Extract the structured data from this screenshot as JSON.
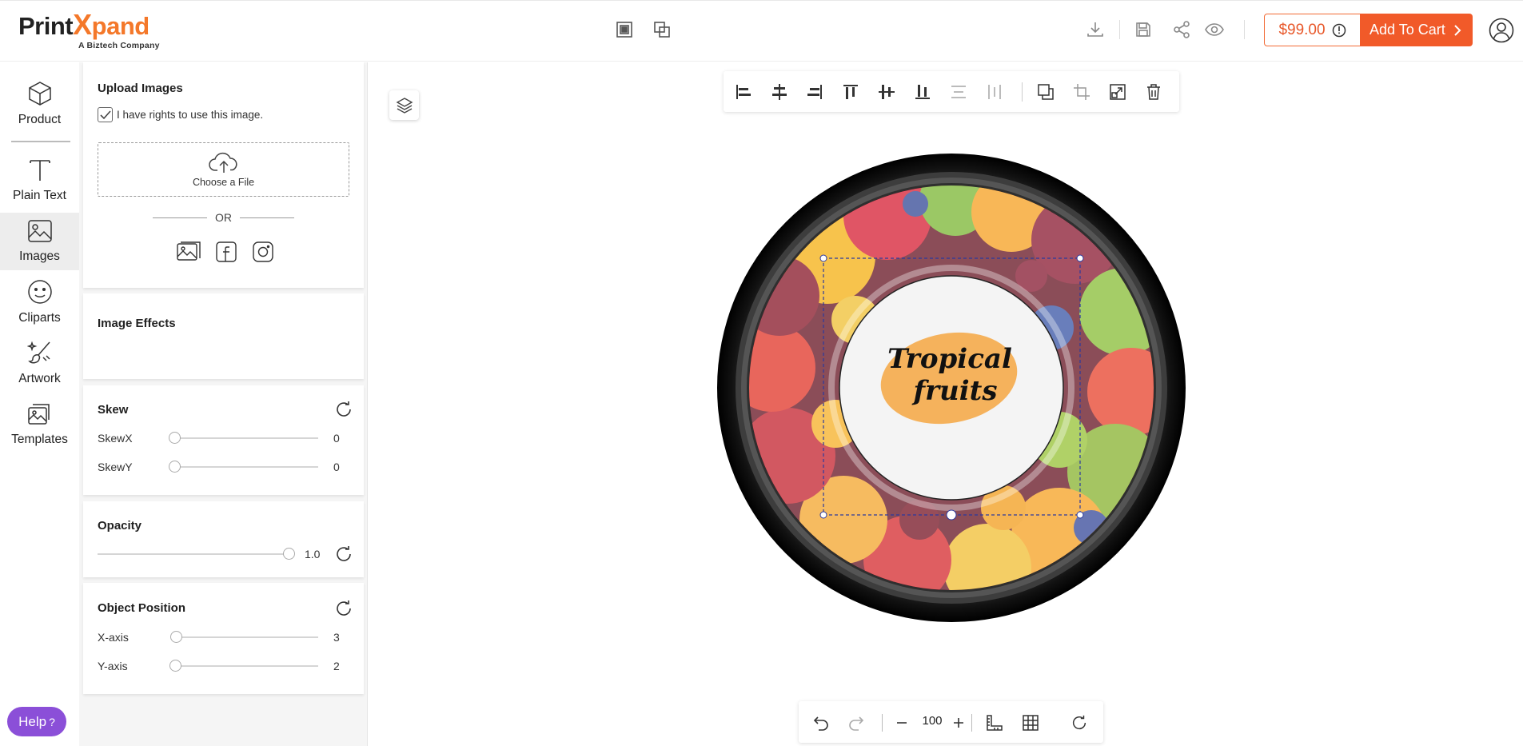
{
  "header": {
    "logo": {
      "brand_part1": "Print",
      "brand_x": "X",
      "brand_part2": "pand",
      "tagline": "A Biztech Company"
    },
    "price": "$99.00",
    "add_to_cart_label": "Add To Cart"
  },
  "nav": {
    "items": [
      {
        "label": "Product",
        "icon": "cube-icon"
      },
      {
        "label": "Plain Text",
        "icon": "text-icon"
      },
      {
        "label": "Images",
        "icon": "image-icon",
        "active": true
      },
      {
        "label": "Cliparts",
        "icon": "smiley-icon"
      },
      {
        "label": "Artwork",
        "icon": "brush-icon"
      },
      {
        "label": "Templates",
        "icon": "templates-icon"
      }
    ]
  },
  "panel": {
    "upload": {
      "title": "Upload Images",
      "rights_label": "I have rights to use this image.",
      "rights_checked": true,
      "choose_file_label": "Choose a File",
      "or_label": "OR"
    },
    "effects": {
      "title": "Image Effects"
    },
    "skew": {
      "title": "Skew",
      "x_label": "SkewX",
      "x_value": "0",
      "y_label": "SkewY",
      "y_value": "0"
    },
    "opacity": {
      "title": "Opacity",
      "value": "1.0"
    },
    "position": {
      "title": "Object Position",
      "x_label": "X-axis",
      "x_value": "3",
      "y_label": "Y-axis",
      "y_value": "2"
    }
  },
  "canvas": {
    "zoom": "100",
    "label_text": {
      "line1": "Tropical",
      "line2": "fruits"
    }
  },
  "help": {
    "label": "Help",
    "glyph": "?"
  },
  "colors": {
    "accent": "#f15a29",
    "help": "#8b4fd8",
    "selection": "#2b3a9e"
  }
}
